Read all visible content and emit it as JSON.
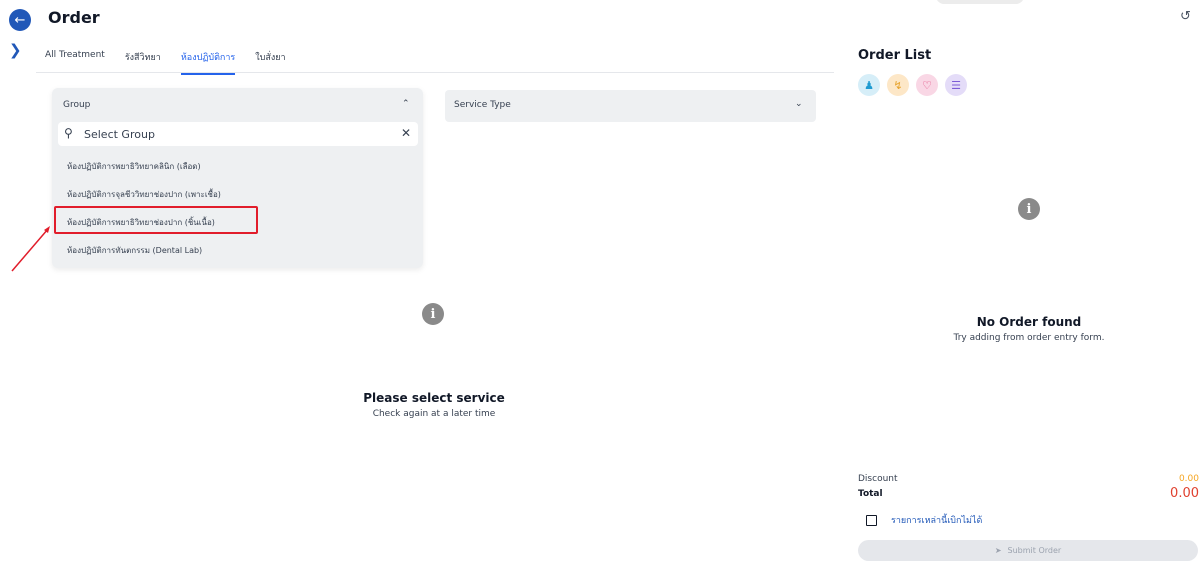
{
  "header": {
    "back_icon": "arrow-left-icon",
    "title": "Order",
    "expand_icon": "chevron-right-icon",
    "history_icon": "history-icon"
  },
  "tabs": [
    {
      "label": "All Treatment",
      "active": false
    },
    {
      "label": "รังสีวิทยา",
      "active": false
    },
    {
      "label": "ห้องปฏิบัติการ",
      "active": true
    },
    {
      "label": "ใบสั่งยา",
      "active": false
    }
  ],
  "group_dropdown": {
    "label": "Group",
    "expanded": true,
    "search_placeholder": "Select Group",
    "items": [
      {
        "label": "ห้องปฏิบัติการพยาธิวิทยาคลินิก (เลือด)",
        "highlighted": false
      },
      {
        "label": "ห้องปฏิบัติการจุลชีววิทยาช่องปาก (เพาะเชื้อ)",
        "highlighted": false
      },
      {
        "label": "ห้องปฏิบัติการพยาธิวิทยาช่องปาก (ชิ้นเนื้อ)",
        "highlighted": true
      },
      {
        "label": "ห้องปฏิบัติการทันตกรรม (Dental Lab)",
        "highlighted": false
      }
    ]
  },
  "service_type": {
    "label": "Service Type"
  },
  "service_empty": {
    "title": "Please select service",
    "subtitle": "Check again at a later time"
  },
  "order_list": {
    "title": "Order List",
    "category_buttons": [
      {
        "icon": "dental-chair-icon",
        "bg": "#d6eef8",
        "fg": "#1f9bd1"
      },
      {
        "icon": "route-icon",
        "bg": "#fde7c7",
        "fg": "#e6a22b"
      },
      {
        "icon": "heart-icon",
        "bg": "#f9d7e5",
        "fg": "#e0457b"
      },
      {
        "icon": "list-icon",
        "bg": "#e4dcf8",
        "fg": "#7c5cd6"
      }
    ],
    "empty_title": "No Order found",
    "empty_subtitle": "Try adding from order entry form."
  },
  "summary": {
    "discount_label": "Discount",
    "discount_value": "0.00",
    "total_label": "Total",
    "total_value": "0.00"
  },
  "non_billable_label": "รายการเหล่านี้เบิกไม่ได้",
  "submit_label": "Submit Order",
  "colors": {
    "primary": "#2158b8",
    "highlight": "#e11d2b",
    "total": "#e0412f",
    "discount": "#f5a623"
  }
}
